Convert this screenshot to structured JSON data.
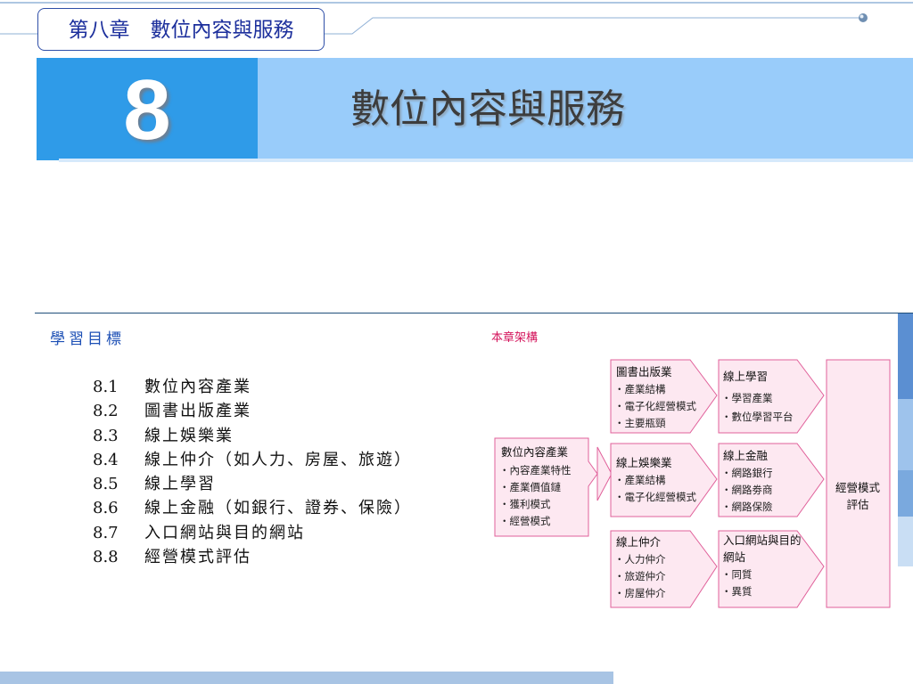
{
  "header": {
    "chapter_tab": "第八章　數位內容與服務"
  },
  "banner": {
    "number": "8",
    "title": "數位內容與服務"
  },
  "objectives": {
    "heading": "學習目標",
    "items": [
      {
        "num": "8.1",
        "text": "數位內容產業"
      },
      {
        "num": "8.2",
        "text": "圖書出版產業"
      },
      {
        "num": "8.3",
        "text": "線上娛樂業"
      },
      {
        "num": "8.4",
        "text": "線上仲介（如人力、房屋、旅遊）"
      },
      {
        "num": "8.5",
        "text": "線上學習"
      },
      {
        "num": "8.6",
        "text": "線上金融（如銀行、證券、保險）"
      },
      {
        "num": "8.7",
        "text": "入口網站與目的網站"
      },
      {
        "num": "8.8",
        "text": "經營模式評估"
      }
    ]
  },
  "structure": {
    "label": "本章架構",
    "root": {
      "title": "數位內容產業",
      "items": [
        "‧內容產業特性",
        "‧產業價值鏈",
        "‧獲利模式",
        "‧經營模式"
      ]
    },
    "col1": [
      {
        "title": "圖書出版業",
        "items": [
          "‧產業結構",
          "‧電子化經營模式",
          "‧主要瓶頸"
        ]
      },
      {
        "title": "線上娛樂業",
        "items": [
          "‧產業結構",
          "‧電子化經營模式"
        ]
      },
      {
        "title": "線上仲介",
        "items": [
          "‧人力仲介",
          "‧旅遊仲介",
          "‧房屋仲介"
        ]
      }
    ],
    "col2": [
      {
        "title": "線上學習",
        "items": [
          "‧學習產業",
          "‧數位學習平台"
        ]
      },
      {
        "title": "線上金融",
        "items": [
          "‧網路銀行",
          "‧網路劵商",
          "‧網路保險"
        ]
      },
      {
        "title": "入口網站與目的",
        "title2": "網站",
        "items": [
          "‧同質",
          "‧異質"
        ]
      }
    ],
    "final": {
      "line1": "經營模式",
      "line2": "評估"
    }
  },
  "colors": {
    "banner_dark": "#2f9be8",
    "banner_light": "#99ccfa",
    "accent_blue": "#1c4fb5",
    "diagram_border": "#e0609a",
    "diagram_fill": "#fde8f1",
    "structure_label": "#d4155c"
  }
}
